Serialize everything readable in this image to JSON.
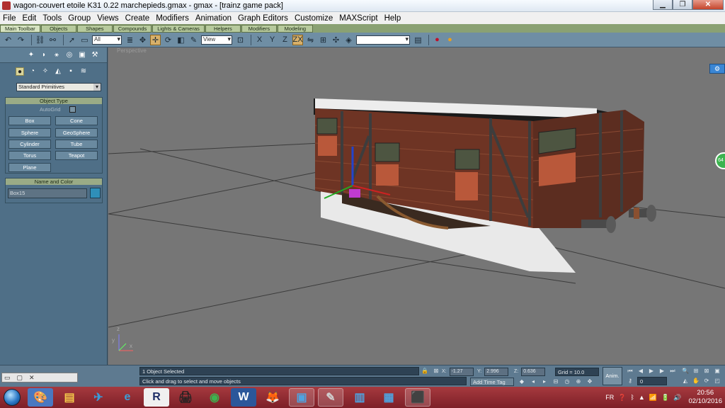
{
  "window": {
    "title": "wagon-couvert etoile K31 0.22 marchepieds.gmax - gmax - [trainz game pack]",
    "minimize": "▁",
    "restore": "❐",
    "close": "✕"
  },
  "menu": [
    "File",
    "Edit",
    "Tools",
    "Group",
    "Views",
    "Create",
    "Modifiers",
    "Animation",
    "Graph Editors",
    "Customize",
    "MAXScript",
    "Help"
  ],
  "tabs": [
    "Main Toolbar",
    "Objects",
    "Shapes",
    "Compounds",
    "Lights & Cameras",
    "Helpers",
    "Modifiers",
    "Modeling"
  ],
  "toolbar": {
    "selection_filter": "All",
    "ref_coord": "View",
    "named_selection": "",
    "axis_x": "X",
    "axis_y": "Y",
    "axis_z": "Z",
    "axis_xy": "ZX"
  },
  "create_panel": {
    "category_dropdown": "Standard Primitives",
    "object_type_title": "Object Type",
    "autogrid_label": "AutoGrid",
    "buttons": [
      "Box",
      "Cone",
      "Sphere",
      "GeoSphere",
      "Cylinder",
      "Tube",
      "Torus",
      "Teapot",
      "Plane"
    ],
    "name_color_title": "Name and Color",
    "object_name": "Box15",
    "object_color": "#2f8fb9"
  },
  "viewport": {
    "label": "Perspective"
  },
  "status": {
    "selection": "1 Object Selected",
    "prompt": "Click and drag to select and move objects",
    "x_label": "X:",
    "x_value": "-1.27",
    "y_label": "Y:",
    "y_value": "2.996",
    "z_label": "Z:",
    "z_value": "0.636",
    "grid": "Grid = 10.0",
    "add_time_tag": "Add Time Tag",
    "anim_button": "Anim.",
    "frame_value": "0"
  },
  "taskbar": {
    "language": "FR",
    "time": "20:56",
    "date": "02/10/2016",
    "apps": [
      "folder-icon",
      "bird-icon",
      "ie-icon",
      "r-icon",
      "scanner-icon",
      "chrome-icon",
      "word-icon",
      "firefox-icon",
      "photo-viewer-icon",
      "gimp-icon",
      "grid-app-icon",
      "folder2-icon",
      "trainz-icon"
    ]
  },
  "colors": {
    "accent": "#6f8ea4",
    "taskbar": "#a63a3f",
    "viewport": "#767676"
  }
}
